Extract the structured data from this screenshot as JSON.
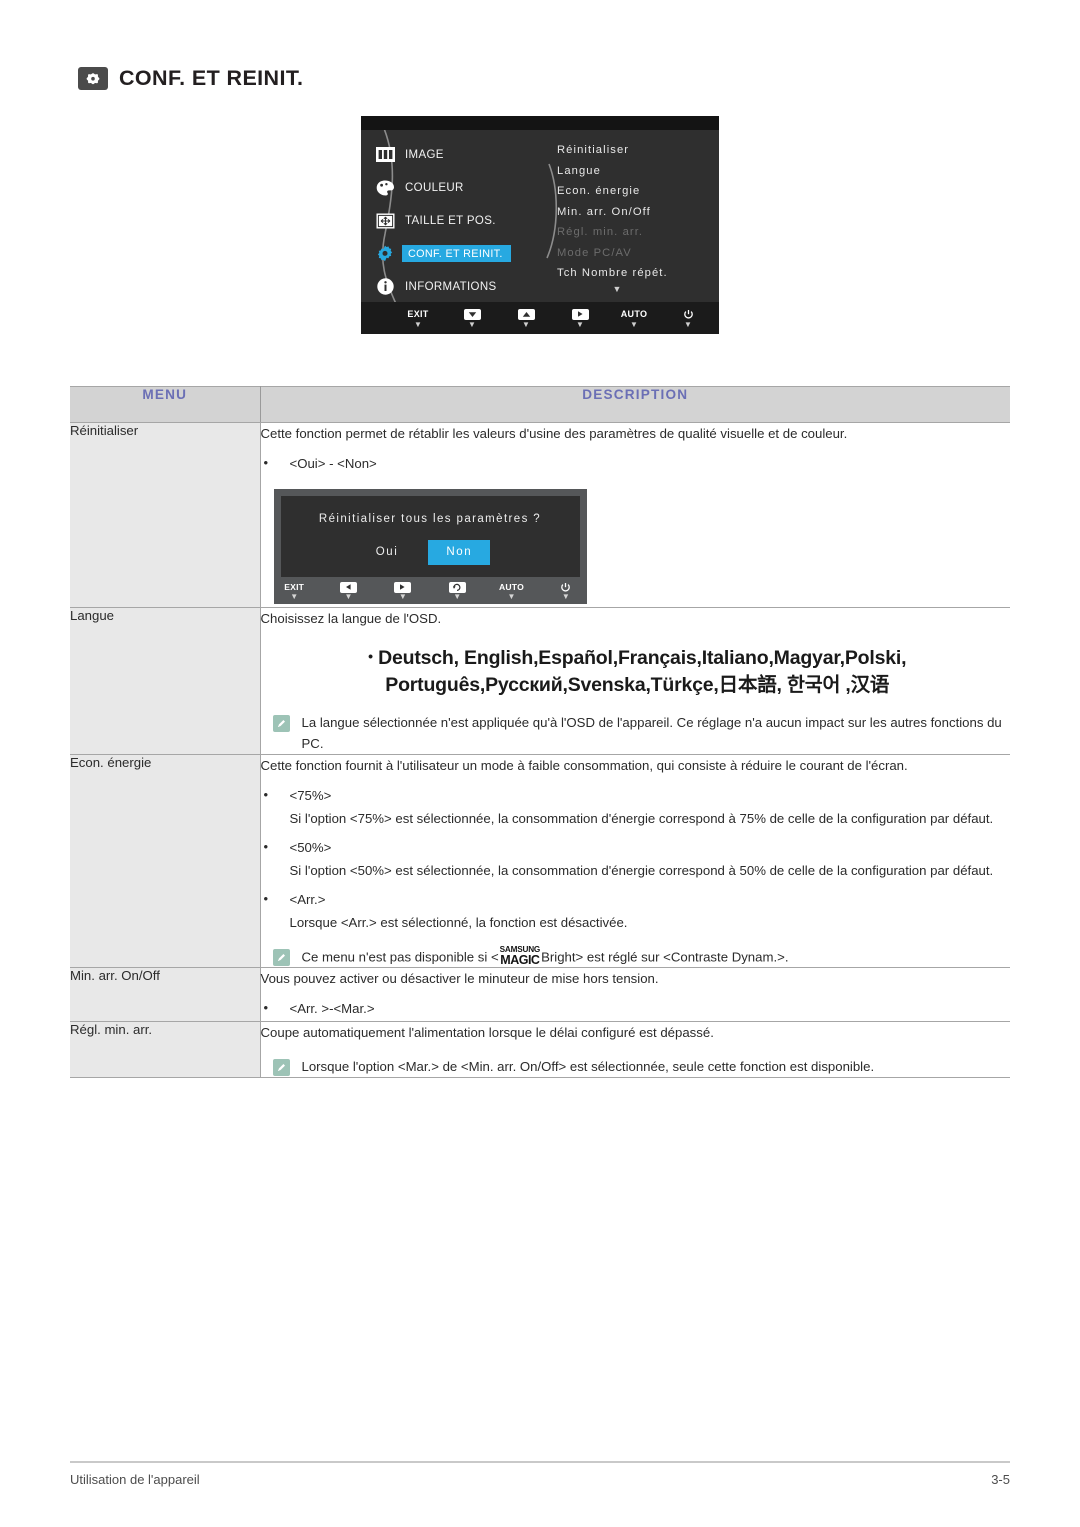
{
  "page": {
    "title": "CONF. ET REINIT.",
    "header_icon": "settings-reset-icon",
    "footer_left": "Utilisation de l'appareil",
    "footer_page": "3-5"
  },
  "osd": {
    "left_menu": [
      {
        "label": "IMAGE",
        "icon": "image-icon",
        "selected": false
      },
      {
        "label": "COULEUR",
        "icon": "color-icon",
        "selected": false
      },
      {
        "label": "TAILLE ET POS.",
        "icon": "size-position-icon",
        "selected": false
      },
      {
        "label": "CONF. ET REINIT.",
        "icon": "gear-icon",
        "selected": true
      },
      {
        "label": "INFORMATIONS",
        "icon": "info-icon",
        "selected": false
      }
    ],
    "submenu": [
      {
        "label": "Réinitialiser",
        "disabled": false
      },
      {
        "label": "Langue",
        "disabled": false
      },
      {
        "label": "Econ. énergie",
        "disabled": false
      },
      {
        "label": "Min. arr. On/Off",
        "disabled": false
      },
      {
        "label": "Régl. min. arr.",
        "disabled": true
      },
      {
        "label": "Mode PC/AV",
        "disabled": true
      },
      {
        "label": "Tch Nombre répét.",
        "disabled": false
      }
    ],
    "scroll_caret": "▼",
    "buttons": [
      {
        "label": "EXIT",
        "icon": "exit-button"
      },
      {
        "label": "▼",
        "icon": "down-button"
      },
      {
        "label": "▲",
        "icon": "up-button"
      },
      {
        "label": "▶",
        "icon": "enter-button"
      },
      {
        "label": "AUTO",
        "icon": "auto-button"
      },
      {
        "label": "⏻",
        "icon": "power-button"
      }
    ],
    "highlight_color": "#27a9e1"
  },
  "table": {
    "headers": {
      "menu": "MENU",
      "description": "DESCRIPTION"
    },
    "header_text_color": "#6b6fb5",
    "rows": {
      "reinitialiser": {
        "menu": "Réinitialiser",
        "intro": "Cette fonction permet de rétablir les valeurs d'usine des paramètres de qualité visuelle et de couleur.",
        "bullet": "<Oui> - <Non>",
        "dialog": {
          "question": "Réinitialiser tous les paramètres ?",
          "option_yes": "Oui",
          "option_no": "Non",
          "selected": "Non",
          "buttons": [
            {
              "label": "EXIT",
              "icon": "exit-button"
            },
            {
              "label": "◀",
              "icon": "left-button"
            },
            {
              "label": "▶",
              "icon": "right-button"
            },
            {
              "label": "↺",
              "icon": "enter-button"
            },
            {
              "label": "AUTO",
              "icon": "auto-button"
            },
            {
              "label": "⏻",
              "icon": "power-button"
            }
          ]
        }
      },
      "langue": {
        "menu": "Langue",
        "intro": "Choisissez la langue de l'OSD.",
        "languages_line1": "Deutsch, English,Español,Français,Italiano,Magyar,Polski,",
        "languages_line2": "Português,Русский,Svenska,Türkçe,日本語, 한국어 ,汉语",
        "note": "La langue sélectionnée n'est appliquée qu'à l'OSD de l'appareil. Ce réglage n'a aucun impact sur les autres fonctions du PC."
      },
      "econ_energie": {
        "menu": "Econ. énergie",
        "intro": "Cette fonction fournit à l'utilisateur un mode à faible consommation, qui consiste à réduire le courant de l'écran.",
        "items": [
          {
            "bullet": "<75%>",
            "detail": "Si l'option <75%> est sélectionnée, la consommation d'énergie correspond à 75% de celle de la configuration par défaut."
          },
          {
            "bullet": "<50%>",
            "detail": "Si l'option <50%> est sélectionnée, la consommation d'énergie correspond à 50% de celle de la configuration par défaut."
          },
          {
            "bullet": "<Arr.>",
            "detail": "Lorsque <Arr.> est sélectionné, la fonction est désactivée."
          }
        ],
        "note_before": "Ce menu n'est pas disponible si <",
        "note_logo_line1": "SAMSUNG",
        "note_logo_line2": "MAGIC",
        "note_after": "Bright> est réglé sur <Contraste Dynam.>."
      },
      "min_arr_onoff": {
        "menu": "Min. arr. On/Off",
        "intro": "Vous pouvez activer ou désactiver le minuteur de mise hors tension.",
        "bullet": "<Arr. >-<Mar.>"
      },
      "regl_min_arr": {
        "menu": "Régl. min. arr.",
        "intro": "Coupe automatiquement l'alimentation lorsque le délai configuré est dépassé.",
        "note": "Lorsque l'option <Mar.> de <Min. arr. On/Off> est sélectionnée, seule cette fonction est disponible."
      }
    }
  }
}
